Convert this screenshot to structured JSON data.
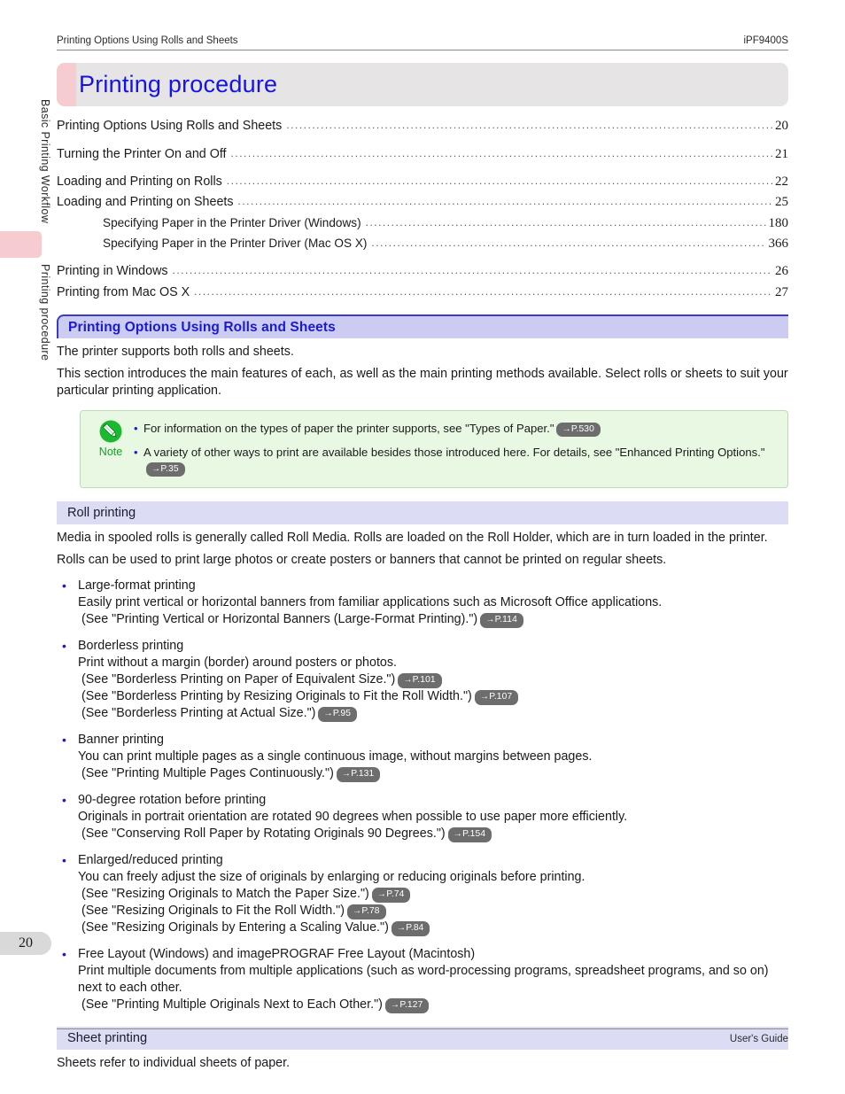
{
  "sidebar": {
    "tabs": [
      {
        "label": "Basic Printing Workflow"
      },
      {
        "label": "Printing procedure"
      }
    ],
    "page_number": "20",
    "marker_color": "#f6ccd1"
  },
  "header": {
    "left": "Printing Options Using Rolls and Sheets",
    "right": "iPF9400S"
  },
  "title_banner": {
    "title": "Printing procedure",
    "title_color": "#1414e6",
    "band_color": "#f6ccd1",
    "fill_color": "#e6e4e4"
  },
  "toc": {
    "entries": [
      {
        "label": "Printing Options Using Rolls and Sheets",
        "page": "20",
        "indent": false,
        "gap_after": true
      },
      {
        "label": "Turning the Printer On and Off",
        "page": "21",
        "indent": false,
        "gap_after": true
      },
      {
        "label": "Loading and Printing on Rolls",
        "page": "22",
        "indent": false,
        "gap_after": false
      },
      {
        "label": "Loading and Printing on Sheets",
        "page": "25",
        "indent": false,
        "gap_after": false
      },
      {
        "label": "Specifying Paper in the Printer Driver (Windows)",
        "page": "180",
        "indent": true,
        "gap_after": false
      },
      {
        "label": "Specifying Paper in the Printer Driver (Mac OS X)",
        "page": "366",
        "indent": true,
        "gap_after": true
      },
      {
        "label": "Printing in Windows",
        "page": "26",
        "indent": false,
        "gap_after": false
      },
      {
        "label": "Printing from Mac OS X",
        "page": "27",
        "indent": false,
        "gap_after": false
      }
    ]
  },
  "section": {
    "heading": "Printing Options Using Rolls and Sheets",
    "heading_color": "#1a1ad0",
    "heading_bg": "#ccccf2",
    "paragraphs": [
      "The printer supports both rolls and sheets.",
      "This section introduces the main features of each, as well as the main printing methods available. Select rolls or sheets to suit your particular printing application."
    ]
  },
  "note": {
    "label": "Note",
    "label_color": "#16a024",
    "bg_color": "#e8f8e3",
    "items": [
      {
        "text": "For information on the types of paper the printer supports, see \"Types of Paper.\"",
        "ref": "→P.530",
        "ref_on_newline": false
      },
      {
        "text": "A variety of other ways to print are available besides those introduced here. For details, see \"Enhanced Printing Options.\"",
        "ref": "→P.35",
        "ref_on_newline": true
      }
    ]
  },
  "roll_printing": {
    "heading": "Roll printing",
    "paragraphs": [
      "Media in spooled rolls is generally called Roll Media. Rolls are loaded on the Roll Holder, which are in turn loaded in the printer.",
      "Rolls can be used to print large photos or create posters or banners that cannot be printed on regular sheets."
    ],
    "bullets": [
      {
        "title": "Large-format printing",
        "lines": [
          {
            "text": "Easily print vertical or horizontal banners from familiar applications such as Microsoft Office applications.",
            "ref": "",
            "indent": false
          }
        ],
        "refs": [
          {
            "text": "(See \"Printing Vertical or Horizontal Banners (Large-Format Printing).\")",
            "ref": "→P.114"
          }
        ]
      },
      {
        "title": "Borderless printing",
        "lines": [
          {
            "text": "Print without a margin (border) around posters or photos.",
            "ref": "",
            "indent": false
          }
        ],
        "refs": [
          {
            "text": "(See \"Borderless Printing on Paper of Equivalent Size.\")",
            "ref": "→P.101"
          },
          {
            "text": "(See \"Borderless Printing by Resizing Originals to Fit the Roll Width.\")",
            "ref": "→P.107"
          },
          {
            "text": "(See \"Borderless Printing at Actual Size.\")",
            "ref": "→P.95"
          }
        ]
      },
      {
        "title": "Banner printing",
        "lines": [
          {
            "text": "You can print multiple pages as a single continuous image, without margins between pages.",
            "ref": "",
            "indent": false
          }
        ],
        "refs": [
          {
            "text": "(See \"Printing Multiple Pages Continuously.\")",
            "ref": "→P.131"
          }
        ]
      },
      {
        "title": "90-degree rotation before printing",
        "lines": [
          {
            "text": "Originals in portrait orientation are rotated 90 degrees when possible to use paper more efficiently.",
            "ref": "",
            "indent": false
          }
        ],
        "refs": [
          {
            "text": "(See \"Conserving Roll Paper by Rotating Originals 90 Degrees.\")",
            "ref": "→P.154"
          }
        ]
      },
      {
        "title": "Enlarged/reduced printing",
        "lines": [
          {
            "text": "You can freely adjust the size of originals by enlarging or reducing originals before printing.",
            "ref": "",
            "indent": false
          }
        ],
        "refs": [
          {
            "text": "(See \"Resizing Originals to Match the Paper Size.\")",
            "ref": "→P.74"
          },
          {
            "text": "(See \"Resizing Originals to Fit the Roll Width.\")",
            "ref": "→P.78"
          },
          {
            "text": "(See \"Resizing Originals by Entering a Scaling Value.\")",
            "ref": "→P.84"
          }
        ]
      },
      {
        "title": "Free Layout (Windows) and imagePROGRAF Free Layout (Macintosh)",
        "lines": [
          {
            "text": "Print multiple documents from multiple applications (such as word-processing programs, spreadsheet programs, and so on) next to each other.",
            "ref": "",
            "indent": false
          }
        ],
        "refs": [
          {
            "text": "(See \"Printing Multiple Originals Next to Each Other.\")",
            "ref": "→P.127"
          }
        ]
      }
    ]
  },
  "sheet_printing": {
    "heading": "Sheet printing",
    "paragraphs": [
      "Sheets refer to individual sheets of paper."
    ]
  },
  "footer": {
    "right": "User's Guide"
  }
}
